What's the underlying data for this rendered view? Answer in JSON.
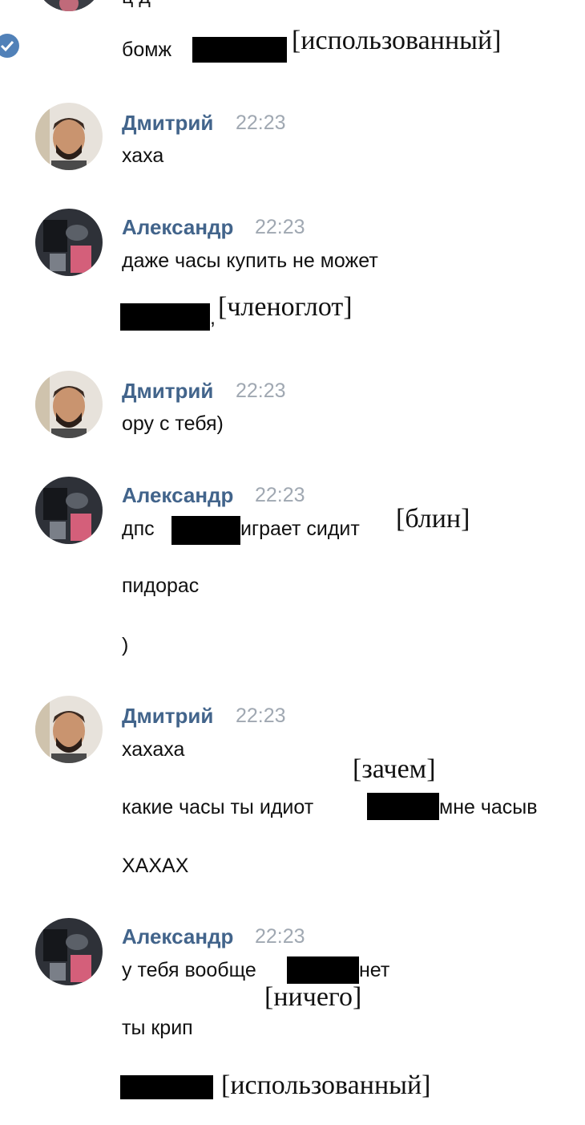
{
  "top": {
    "partial_line": "ц д",
    "msg": "бомж",
    "annot": "[использованный]"
  },
  "colors": {
    "name": "#42648b",
    "time": "#a0a8b2",
    "check": "#5181b8",
    "redaction": "#000000"
  },
  "groups": [
    {
      "author": "Дмитрий",
      "time": "22:23",
      "messages": [
        "хаха"
      ]
    },
    {
      "author": "Александр",
      "time": "22:23",
      "messages": [
        "даже часы купить не может",
        ","
      ],
      "annot": "[членоглот]"
    },
    {
      "author": "Дмитрий",
      "time": "22:23",
      "messages": [
        "ору с тебя)"
      ]
    },
    {
      "author": "Александр",
      "time": "22:23",
      "messages": [
        "дпс",
        "играет сидит",
        "пидорас",
        ")"
      ],
      "annot": "[блин]"
    },
    {
      "author": "Дмитрий",
      "time": "22:23",
      "messages": [
        "хахаха",
        "какие часы ты идиот",
        "мне часыв",
        "ХАХАХ"
      ],
      "annot": "[зачем]"
    },
    {
      "author": "Александр",
      "time": "22:23",
      "messages": [
        "у тебя вообще",
        "нет",
        "ты крип"
      ],
      "annot": "[ничего]",
      "annot2": "[использованный]"
    }
  ]
}
